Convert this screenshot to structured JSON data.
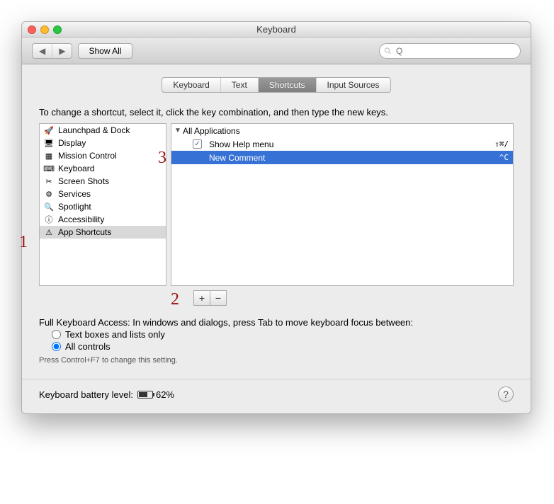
{
  "window": {
    "title": "Keyboard"
  },
  "toolbar": {
    "back_label": "◀",
    "forward_label": "▶",
    "show_all_label": "Show All",
    "search_placeholder": "Q"
  },
  "tabs": [
    {
      "label": "Keyboard",
      "selected": false
    },
    {
      "label": "Text",
      "selected": false
    },
    {
      "label": "Shortcuts",
      "selected": true
    },
    {
      "label": "Input Sources",
      "selected": false
    }
  ],
  "instructions": "To change a shortcut, select it, click the key combination, and then type the new keys.",
  "categories": [
    {
      "label": "Launchpad & Dock",
      "icon": "launchpad-icon",
      "selected": false
    },
    {
      "label": "Display",
      "icon": "display-icon",
      "selected": false
    },
    {
      "label": "Mission Control",
      "icon": "mission-control-icon",
      "selected": false
    },
    {
      "label": "Keyboard",
      "icon": "keyboard-icon",
      "selected": false
    },
    {
      "label": "Screen Shots",
      "icon": "screenshots-icon",
      "selected": false
    },
    {
      "label": "Services",
      "icon": "services-icon",
      "selected": false
    },
    {
      "label": "Spotlight",
      "icon": "spotlight-icon",
      "selected": false
    },
    {
      "label": "Accessibility",
      "icon": "accessibility-icon",
      "selected": false
    },
    {
      "label": "App Shortcuts",
      "icon": "app-shortcuts-icon",
      "selected": true
    }
  ],
  "shortcuts": {
    "group_label": "All Applications",
    "items": [
      {
        "label": "Show Help menu",
        "keys": "⇧⌘/",
        "checked": true,
        "selected": false
      },
      {
        "label": "New Comment",
        "keys": "^C",
        "checked": true,
        "selected": true
      }
    ]
  },
  "add_label": "+",
  "remove_label": "−",
  "fka": {
    "text": "Full Keyboard Access: In windows and dialogs, press Tab to move keyboard focus between:",
    "opt1": "Text boxes and lists only",
    "opt2": "All controls",
    "hint": "Press Control+F7 to change this setting."
  },
  "footer": {
    "battery_label": "Keyboard battery level:",
    "battery_pct": "62%",
    "battery_value": 62
  },
  "annotations": {
    "n1": "1",
    "n2": "2",
    "n3": "3"
  }
}
